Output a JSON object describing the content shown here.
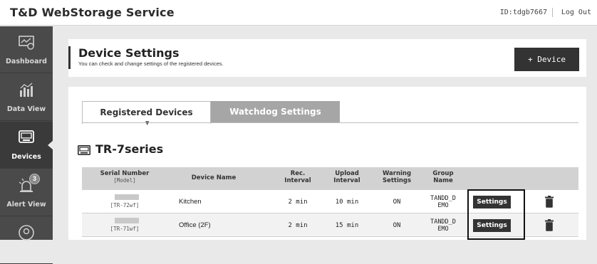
{
  "app": {
    "brand": "T&D WebStorage Service",
    "user_id": "ID:tdgb7667",
    "logout": "Log Out"
  },
  "sidebar": {
    "items": [
      {
        "label": "Dashboard",
        "icon": "dashboard-icon"
      },
      {
        "label": "Data View",
        "icon": "data-view-icon"
      },
      {
        "label": "Devices",
        "icon": "devices-icon",
        "active": true
      },
      {
        "label": "Alert View",
        "icon": "alert-icon",
        "badge": "3"
      },
      {
        "label": "",
        "icon": "user-icon"
      }
    ]
  },
  "header": {
    "title": "Device Settings",
    "subtitle": "You can check and change settings of the registered devices.",
    "add_button": "+ Device"
  },
  "tabs": [
    {
      "label": "Registered Devices",
      "active": true
    },
    {
      "label": "Watchdog Settings",
      "active": false
    }
  ],
  "series": {
    "title": "TR-7series"
  },
  "table": {
    "headers": {
      "serial": "Serial Number",
      "model": "[Model]",
      "device_name": "Device Name",
      "rec_interval_1": "Rec.",
      "rec_interval_2": "Interval",
      "upload_interval_1": "Upload",
      "upload_interval_2": "Interval",
      "warning_1": "Warning",
      "warning_2": "Settings",
      "group_1": "Group",
      "group_2": "Name"
    },
    "rows": [
      {
        "model": "[TR-72wf]",
        "device_name": "Kitchen",
        "rec_interval": "2 min",
        "upload_interval": "10 min",
        "warning": "ON",
        "group_1": "TANDD_D",
        "group_2": "EMO",
        "settings_label": "Settings"
      },
      {
        "model": "[TR-71wf]",
        "device_name": "Office (2F)",
        "rec_interval": "2 min",
        "upload_interval": "15 min",
        "warning": "ON",
        "group_1": "TANDD_D",
        "group_2": "EMO",
        "settings_label": "Settings"
      }
    ]
  },
  "colors": {
    "sidebar": "#4a4a4a",
    "header_bar": "#333333",
    "tab_inactive": "#a6a6a6",
    "button": "#333333"
  }
}
